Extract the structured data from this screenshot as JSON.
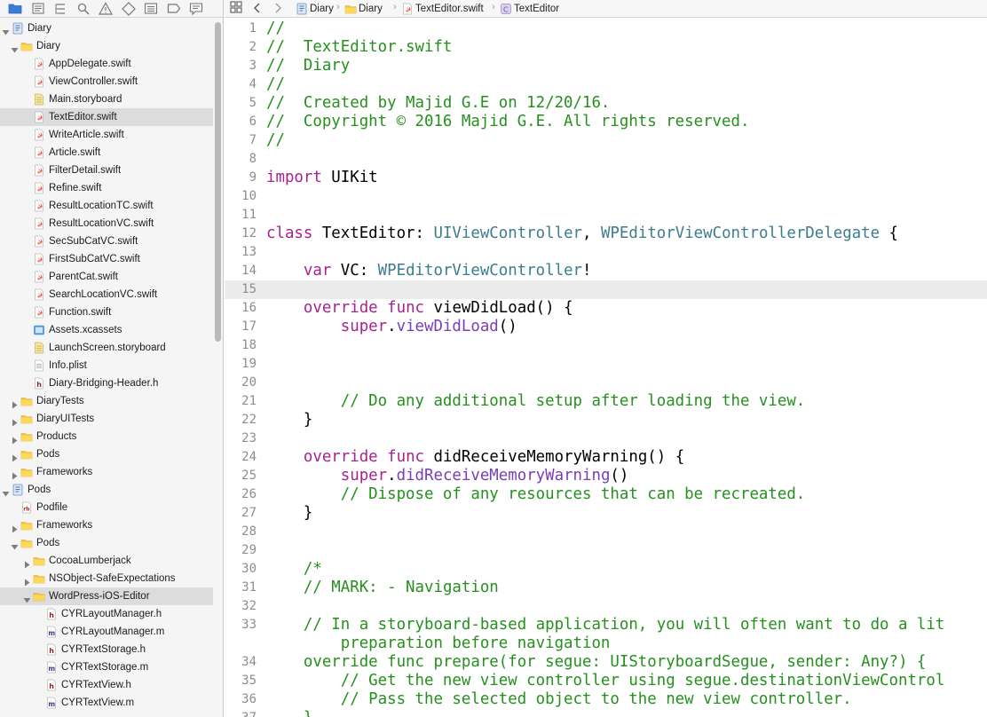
{
  "navigator": {
    "toolbar_icons": [
      "folder-icon",
      "source-control-icon",
      "hierarchy-icon",
      "search-icon",
      "warning-icon",
      "test-icon",
      "debug-icon",
      "breakpoint-icon",
      "report-icon"
    ],
    "items": [
      {
        "label": "Diary",
        "type": "project",
        "depth": 0,
        "open": true
      },
      {
        "label": "Diary",
        "type": "folder",
        "depth": 1,
        "open": true
      },
      {
        "label": "AppDelegate.swift",
        "type": "swift",
        "depth": 2
      },
      {
        "label": "ViewController.swift",
        "type": "swift",
        "depth": 2
      },
      {
        "label": "Main.storyboard",
        "type": "storyboard",
        "depth": 2
      },
      {
        "label": "TextEditor.swift",
        "type": "swift",
        "depth": 2,
        "selected": true
      },
      {
        "label": "WriteArticle.swift",
        "type": "swift",
        "depth": 2
      },
      {
        "label": "Article.swift",
        "type": "swift",
        "depth": 2
      },
      {
        "label": "FilterDetail.swift",
        "type": "swift",
        "depth": 2
      },
      {
        "label": "Refine.swift",
        "type": "swift",
        "depth": 2
      },
      {
        "label": "ResultLocationTC.swift",
        "type": "swift",
        "depth": 2
      },
      {
        "label": "ResultLocationVC.swift",
        "type": "swift",
        "depth": 2
      },
      {
        "label": "SecSubCatVC.swift",
        "type": "swift",
        "depth": 2
      },
      {
        "label": "FirstSubCatVC.swift",
        "type": "swift",
        "depth": 2
      },
      {
        "label": "ParentCat.swift",
        "type": "swift",
        "depth": 2
      },
      {
        "label": "SearchLocationVC.swift",
        "type": "swift",
        "depth": 2
      },
      {
        "label": "Function.swift",
        "type": "swift",
        "depth": 2
      },
      {
        "label": "Assets.xcassets",
        "type": "assets",
        "depth": 2
      },
      {
        "label": "LaunchScreen.storyboard",
        "type": "storyboard",
        "depth": 2
      },
      {
        "label": "Info.plist",
        "type": "plist",
        "depth": 2
      },
      {
        "label": "Diary-Bridging-Header.h",
        "type": "header",
        "depth": 2
      },
      {
        "label": "DiaryTests",
        "type": "folder",
        "depth": 1,
        "open": false
      },
      {
        "label": "DiaryUITests",
        "type": "folder",
        "depth": 1,
        "open": false
      },
      {
        "label": "Products",
        "type": "folder",
        "depth": 1,
        "open": false
      },
      {
        "label": "Pods",
        "type": "folder",
        "depth": 1,
        "open": false
      },
      {
        "label": "Frameworks",
        "type": "folder",
        "depth": 1,
        "open": false
      },
      {
        "label": "Pods",
        "type": "project",
        "depth": 0,
        "open": true
      },
      {
        "label": "Podfile",
        "type": "podfile",
        "depth": 1
      },
      {
        "label": "Frameworks",
        "type": "folder",
        "depth": 1,
        "open": false
      },
      {
        "label": "Pods",
        "type": "folder",
        "depth": 1,
        "open": true
      },
      {
        "label": "CocoaLumberjack",
        "type": "folder",
        "depth": 2,
        "open": false
      },
      {
        "label": "NSObject-SafeExpectations",
        "type": "folder",
        "depth": 2,
        "open": false
      },
      {
        "label": "WordPress-iOS-Editor",
        "type": "folder",
        "depth": 2,
        "open": true,
        "selected": true
      },
      {
        "label": "CYRLayoutManager.h",
        "type": "header",
        "depth": 3
      },
      {
        "label": "CYRLayoutManager.m",
        "type": "objc",
        "depth": 3
      },
      {
        "label": "CYRTextStorage.h",
        "type": "header",
        "depth": 3
      },
      {
        "label": "CYRTextStorage.m",
        "type": "objc",
        "depth": 3
      },
      {
        "label": "CYRTextView.h",
        "type": "header",
        "depth": 3
      },
      {
        "label": "CYRTextView.m",
        "type": "objc",
        "depth": 3
      }
    ]
  },
  "jumpbar": {
    "crumbs": [
      {
        "label": "Diary",
        "icon": "project"
      },
      {
        "label": "Diary",
        "icon": "folder"
      },
      {
        "label": "TextEditor.swift",
        "icon": "swift"
      },
      {
        "label": "TextEditor",
        "icon": "class"
      }
    ]
  },
  "editor": {
    "current_line": 15,
    "lines": [
      {
        "n": "1",
        "s": [
          [
            "c",
            "//"
          ]
        ]
      },
      {
        "n": "2",
        "s": [
          [
            "c",
            "//  TextEditor.swift"
          ]
        ]
      },
      {
        "n": "3",
        "s": [
          [
            "c",
            "//  Diary"
          ]
        ]
      },
      {
        "n": "4",
        "s": [
          [
            "c",
            "//"
          ]
        ]
      },
      {
        "n": "5",
        "s": [
          [
            "c",
            "//  Created by Majid G.E on 12/20/16."
          ]
        ]
      },
      {
        "n": "6",
        "s": [
          [
            "c",
            "//  Copyright © 2016 Majid G.E. All rights reserved."
          ]
        ]
      },
      {
        "n": "7",
        "s": [
          [
            "c",
            "//"
          ]
        ]
      },
      {
        "n": "8",
        "s": []
      },
      {
        "n": "9",
        "s": [
          [
            "k",
            "import"
          ],
          [
            "p",
            " UIKit"
          ]
        ]
      },
      {
        "n": "10",
        "s": []
      },
      {
        "n": "11",
        "s": []
      },
      {
        "n": "12",
        "s": [
          [
            "k",
            "class"
          ],
          [
            "p",
            " TextEditor: "
          ],
          [
            "t",
            "UIViewController"
          ],
          [
            "p",
            ", "
          ],
          [
            "t",
            "WPEditorViewControllerDelegate"
          ],
          [
            "p",
            " {"
          ]
        ]
      },
      {
        "n": "13",
        "s": []
      },
      {
        "n": "14",
        "s": [
          [
            "p",
            "    "
          ],
          [
            "k",
            "var"
          ],
          [
            "p",
            " VC: "
          ],
          [
            "t",
            "WPEditorViewController"
          ],
          [
            "p",
            "!"
          ]
        ]
      },
      {
        "n": "15",
        "s": []
      },
      {
        "n": "16",
        "s": [
          [
            "p",
            "    "
          ],
          [
            "k",
            "override"
          ],
          [
            "p",
            " "
          ],
          [
            "k",
            "func"
          ],
          [
            "p",
            " viewDidLoad() {"
          ]
        ]
      },
      {
        "n": "17",
        "s": [
          [
            "p",
            "        "
          ],
          [
            "k",
            "super"
          ],
          [
            "p",
            "."
          ],
          [
            "f",
            "viewDidLoad"
          ],
          [
            "p",
            "()"
          ]
        ]
      },
      {
        "n": "18",
        "s": []
      },
      {
        "n": "19",
        "s": []
      },
      {
        "n": "20",
        "s": []
      },
      {
        "n": "21",
        "s": [
          [
            "p",
            "        "
          ],
          [
            "c",
            "// Do any additional setup after loading the view."
          ]
        ]
      },
      {
        "n": "22",
        "s": [
          [
            "p",
            "    }"
          ]
        ]
      },
      {
        "n": "23",
        "s": []
      },
      {
        "n": "24",
        "s": [
          [
            "p",
            "    "
          ],
          [
            "k",
            "override"
          ],
          [
            "p",
            " "
          ],
          [
            "k",
            "func"
          ],
          [
            "p",
            " didReceiveMemoryWarning() {"
          ]
        ]
      },
      {
        "n": "25",
        "s": [
          [
            "p",
            "        "
          ],
          [
            "k",
            "super"
          ],
          [
            "p",
            "."
          ],
          [
            "f",
            "didReceiveMemoryWarning"
          ],
          [
            "p",
            "()"
          ]
        ]
      },
      {
        "n": "26",
        "s": [
          [
            "p",
            "        "
          ],
          [
            "c",
            "// Dispose of any resources that can be recreated."
          ]
        ]
      },
      {
        "n": "27",
        "s": [
          [
            "p",
            "    }"
          ]
        ]
      },
      {
        "n": "28",
        "s": []
      },
      {
        "n": "29",
        "s": []
      },
      {
        "n": "30",
        "s": [
          [
            "p",
            "    "
          ],
          [
            "c",
            "/*"
          ]
        ]
      },
      {
        "n": "31",
        "s": [
          [
            "p",
            "    "
          ],
          [
            "c",
            "// MARK: - Navigation"
          ]
        ]
      },
      {
        "n": "32",
        "s": []
      },
      {
        "n": "33",
        "s": [
          [
            "p",
            "    "
          ],
          [
            "c",
            "// In a storyboard-based application, you will often want to do a lit"
          ]
        ]
      },
      {
        "n": "",
        "s": [
          [
            "p",
            "        "
          ],
          [
            "c",
            "preparation before navigation"
          ]
        ]
      },
      {
        "n": "34",
        "s": [
          [
            "p",
            "    "
          ],
          [
            "c",
            "override func prepare(for segue: UIStoryboardSegue, sender: Any?) {"
          ]
        ]
      },
      {
        "n": "35",
        "s": [
          [
            "p",
            "        "
          ],
          [
            "c",
            "// Get the new view controller using segue.destinationViewControl"
          ]
        ]
      },
      {
        "n": "36",
        "s": [
          [
            "p",
            "        "
          ],
          [
            "c",
            "// Pass the selected object to the new view controller."
          ]
        ]
      },
      {
        "n": "37",
        "s": [
          [
            "p",
            "    "
          ],
          [
            "c",
            "}"
          ]
        ]
      }
    ]
  },
  "colors": {
    "comment": "#25901d",
    "keyword": "#a6228e",
    "type": "#3b7d8d",
    "function": "#7a3db8"
  }
}
